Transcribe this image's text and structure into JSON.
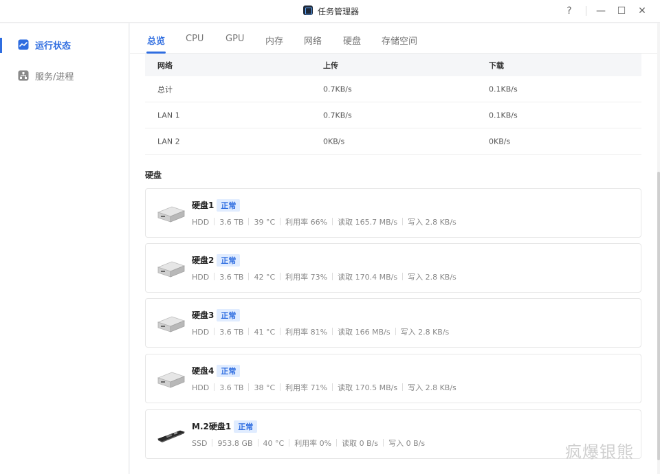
{
  "window": {
    "title": "任务管理器",
    "help_label": "?",
    "minimize_label": "—",
    "maximize_label": "☐",
    "close_label": "✕"
  },
  "sidebar": {
    "items": [
      {
        "label": "运行状态",
        "icon": "chart-line-icon",
        "active": true
      },
      {
        "label": "服务/进程",
        "icon": "sitemap-icon",
        "active": false
      }
    ]
  },
  "tabs": [
    "总览",
    "CPU",
    "GPU",
    "内存",
    "网络",
    "硬盘",
    "存储空间"
  ],
  "network_table": {
    "headers": [
      "网络",
      "上传",
      "下载"
    ],
    "rows": [
      [
        "总计",
        "0.7KB/s",
        "0.1KB/s"
      ],
      [
        "LAN 1",
        "0.7KB/s",
        "0.1KB/s"
      ],
      [
        "LAN 2",
        "0KB/s",
        "0KB/s"
      ]
    ]
  },
  "disk_section_title": "硬盘",
  "disks": [
    {
      "name": "硬盘1",
      "status": "正常",
      "type": "HDD",
      "size": "3.6 TB",
      "temp": "39 °C",
      "usage": "利用率 66%",
      "read": "读取 165.7 MB/s",
      "write": "写入 2.8 KB/s"
    },
    {
      "name": "硬盘2",
      "status": "正常",
      "type": "HDD",
      "size": "3.6 TB",
      "temp": "42 °C",
      "usage": "利用率 73%",
      "read": "读取 170.4 MB/s",
      "write": "写入 2.8 KB/s"
    },
    {
      "name": "硬盘3",
      "status": "正常",
      "type": "HDD",
      "size": "3.6 TB",
      "temp": "41 °C",
      "usage": "利用率 81%",
      "read": "读取 166 MB/s",
      "write": "写入 2.8 KB/s"
    },
    {
      "name": "硬盘4",
      "status": "正常",
      "type": "HDD",
      "size": "3.6 TB",
      "temp": "38 °C",
      "usage": "利用率 71%",
      "read": "读取 170.5 MB/s",
      "write": "写入 2.8 KB/s"
    },
    {
      "name": "M.2硬盘1",
      "status": "正常",
      "type": "SSD",
      "size": "953.8 GB",
      "temp": "40 °C",
      "usage": "利用率 0%",
      "read": "读取 0 B/s",
      "write": "写入 0 B/s"
    }
  ],
  "watermark": "疯爆银熊",
  "colors": {
    "accent": "#2f6de0",
    "badge_bg": "#e0ecff"
  }
}
